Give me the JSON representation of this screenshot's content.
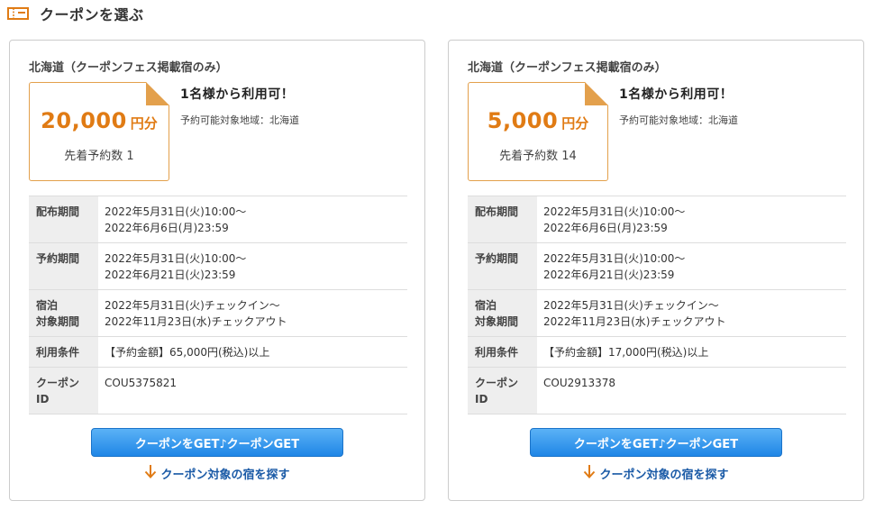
{
  "header": {
    "title": "クーポンを選ぶ",
    "icon": "ticket-icon"
  },
  "colors": {
    "accent": "#e07b14",
    "button": "#1f86e6",
    "link": "#1a5aa6",
    "border": "#cccccc"
  },
  "cards": [
    {
      "region": "北海道（クーポンフェス掲載宿のみ）",
      "amount": "20,000",
      "unit": "円分",
      "count": "先着予約数 1",
      "headline": "1名様から利用可！",
      "area": "予約可能対象地域：北海道",
      "rows": [
        {
          "label": [
            "配布期間"
          ],
          "value": [
            "2022年5月31日(火)10:00～",
            "2022年6月6日(月)23:59"
          ]
        },
        {
          "label": [
            "予約期間"
          ],
          "value": [
            "2022年5月31日(火)10:00～",
            "2022年6月21日(火)23:59"
          ]
        },
        {
          "label": [
            "宿泊",
            "対象期間"
          ],
          "value": [
            "2022年5月31日(火)チェックイン～",
            "2022年11月23日(水)チェックアウト"
          ]
        },
        {
          "label": [
            "利用条件"
          ],
          "value": [
            "【予約金額】65,000円(税込)以上"
          ]
        },
        {
          "label": [
            "クーポン",
            "ID"
          ],
          "value": [
            "COU5375821"
          ]
        }
      ],
      "button": "クーポンをGET♪クーポンGET",
      "link": "クーポン対象の宿を探す"
    },
    {
      "region": "北海道（クーポンフェス掲載宿のみ）",
      "amount": "5,000",
      "unit": "円分",
      "count": "先着予約数 14",
      "headline": "1名様から利用可！",
      "area": "予約可能対象地域：北海道",
      "rows": [
        {
          "label": [
            "配布期間"
          ],
          "value": [
            "2022年5月31日(火)10:00～",
            "2022年6月6日(月)23:59"
          ]
        },
        {
          "label": [
            "予約期間"
          ],
          "value": [
            "2022年5月31日(火)10:00～",
            "2022年6月21日(火)23:59"
          ]
        },
        {
          "label": [
            "宿泊",
            "対象期間"
          ],
          "value": [
            "2022年5月31日(火)チェックイン～",
            "2022年11月23日(水)チェックアウト"
          ]
        },
        {
          "label": [
            "利用条件"
          ],
          "value": [
            "【予約金額】17,000円(税込)以上"
          ]
        },
        {
          "label": [
            "クーポン",
            "ID"
          ],
          "value": [
            "COU2913378"
          ]
        }
      ],
      "button": "クーポンをGET♪クーポンGET",
      "link": "クーポン対象の宿を探す"
    }
  ]
}
